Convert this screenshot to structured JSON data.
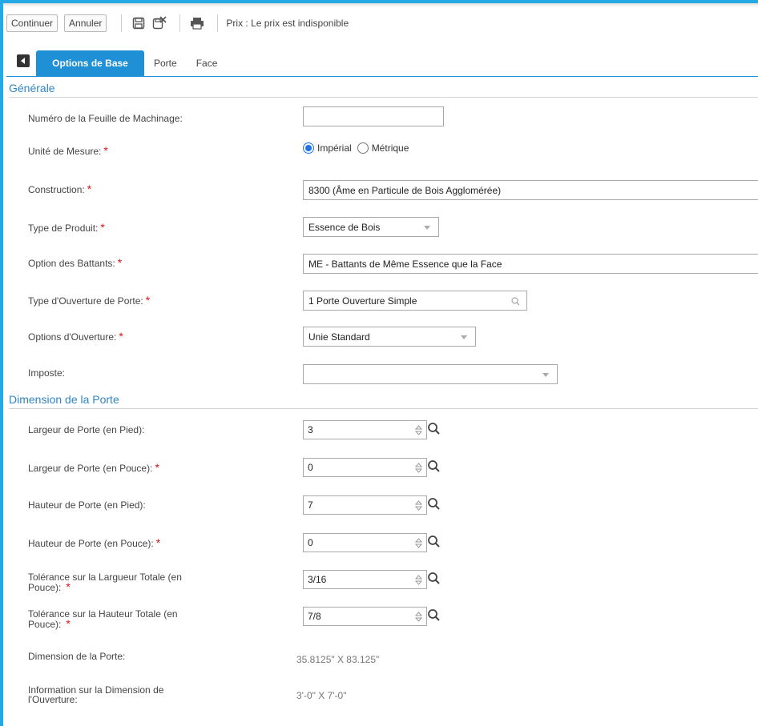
{
  "toolbar": {
    "continue_label": "Continuer",
    "cancel_label": "Annuler",
    "price_text": "Prix : Le prix est indisponible"
  },
  "tabs": [
    {
      "label": "Options de Base"
    },
    {
      "label": "Porte"
    },
    {
      "label": "Face"
    }
  ],
  "general": {
    "title": "Générale",
    "sheet_number_label": "Numéro de la Feuille de Machinage:",
    "sheet_number_value": "",
    "unit_label": "Unité de Mesure:",
    "unit_options": [
      "Impérial",
      "Métrique"
    ],
    "unit_selected": "Impérial",
    "construction_label": "Construction:",
    "construction_value": "8300 (Âme en Particule de Bois Agglomérée)",
    "product_type_label": "Type de Produit:",
    "product_type_value": "Essence de Bois",
    "stile_option_label": "Option des Battants:",
    "stile_option_value": "ME - Battants de Même Essence que la Face",
    "opening_type_label": "Type d'Ouverture de Porte:",
    "opening_type_value": "1 Porte Ouverture Simple",
    "opening_options_label": "Options d'Ouverture:",
    "opening_options_value": "Unie Standard",
    "transom_label": "Imposte:",
    "transom_value": ""
  },
  "dimension": {
    "title": "Dimension de la Porte",
    "width_ft_label": "Largeur de Porte (en Pied):",
    "width_ft_value": "3",
    "width_in_label": "Largeur de Porte (en Pouce):",
    "width_in_value": "0",
    "height_ft_label": "Hauteur de Porte (en Pied):",
    "height_ft_value": "7",
    "height_in_label": "Hauteur de Porte (en Pouce):",
    "height_in_value": "0",
    "tol_width_label_1": "Tolérance sur la Largueur Totale (en",
    "tol_width_label_2": "Pouce):",
    "tol_width_value": "3/16",
    "tol_height_label_1": "Tolérance sur la Hauteur Totale (en",
    "tol_height_label_2": "Pouce):",
    "tol_height_value": "7/8",
    "door_dim_label": "Dimension de la Porte:",
    "door_dim_value": "35.8125\" X 83.125\"",
    "opening_info_label_1": "Information sur la Dimension de",
    "opening_info_label_2": "l'Ouverture:",
    "opening_info_value": "3'-0\" X 7'-0\""
  },
  "required_mark": "*",
  "colors": {
    "accent": "#1f8fd6",
    "frame": "#25a9e6",
    "required": "#dd1111",
    "section": "#2f86c5"
  }
}
